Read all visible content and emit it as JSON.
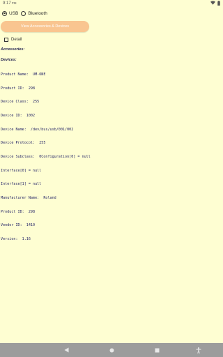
{
  "status_bar": {
    "time": "9:17",
    "time_suffix": "PM",
    "icons": [
      "wifi-icon",
      "battery-icon"
    ]
  },
  "connection": {
    "options": [
      {
        "label": "USB",
        "checked": true
      },
      {
        "label": "Bluetooth",
        "checked": false
      }
    ]
  },
  "actions": {
    "view_button_label": "View Accessories & Devices"
  },
  "detail": {
    "label": "Detail",
    "checked": false
  },
  "sections": {
    "accessories_label": "Accessories:",
    "devices_label": "Devices:"
  },
  "device_lines": [
    "Product Name:  UM-ONE",
    "Product ID:  298",
    "Device Class:  255",
    "Device ID:  1002",
    "Device Name:  /dev/bus/usb/001/002",
    "Device Protocol:  255",
    "Device Subclass:  0Configuration[0] = null",
    "Interface[0] = null",
    "Interface[1] = null",
    "Manufacturer Name:  Roland",
    "Product ID:  298",
    "Vendor ID:  1410",
    "Version:  1.16"
  ],
  "nav_bar": {
    "items": [
      "back-icon",
      "home-icon",
      "recents-icon",
      "accessibility-icon"
    ]
  },
  "colors": {
    "background": "#fefed2",
    "button": "#f9c590",
    "nav_bar": "#9c9c9c",
    "device_text": "#222266"
  }
}
